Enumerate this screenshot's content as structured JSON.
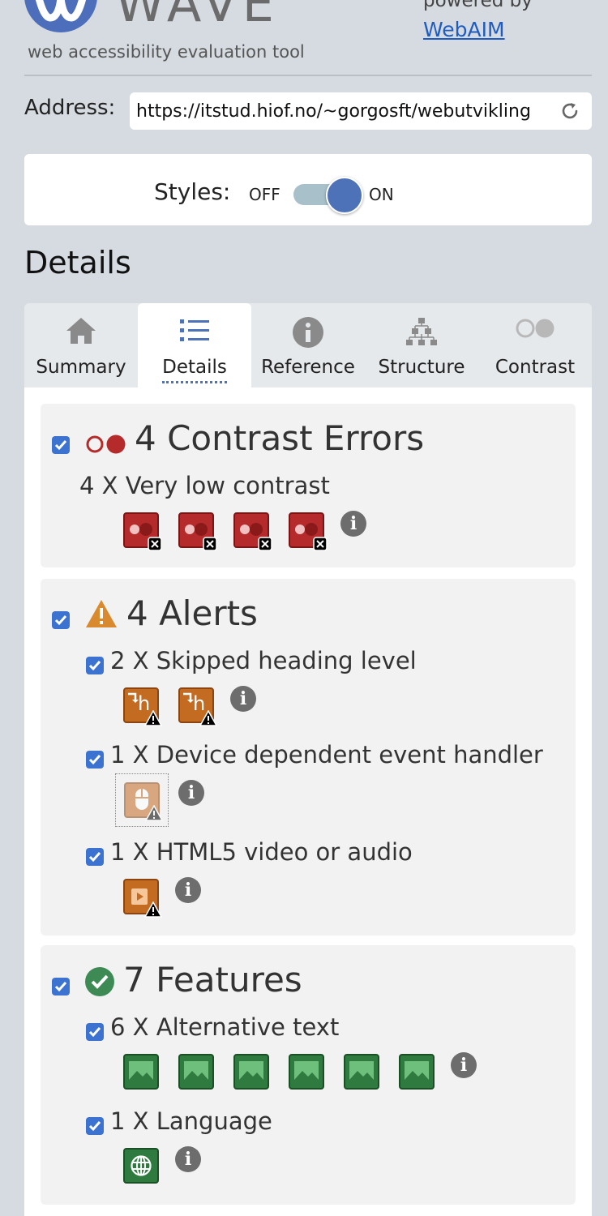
{
  "header": {
    "wordmark": "WAVE",
    "tagline": "web accessibility evaluation tool",
    "powered_by": "powered by",
    "webaim_link": "WebAIM"
  },
  "address": {
    "label": "Address:",
    "value": "https://itstud.hiof.no/~gorgosft/webutvikling"
  },
  "styles": {
    "label": "Styles:",
    "off": "OFF",
    "on": "ON",
    "state": "on"
  },
  "details_heading": "Details",
  "tabs": [
    {
      "label": "Summary",
      "icon": "home-icon"
    },
    {
      "label": "Details",
      "icon": "list-icon",
      "active": true
    },
    {
      "label": "Reference",
      "icon": "info-icon"
    },
    {
      "label": "Structure",
      "icon": "hierarchy-icon"
    },
    {
      "label": "Contrast",
      "icon": "contrast-icon"
    }
  ],
  "groups": {
    "contrast": {
      "title": "4 Contrast Errors",
      "items": [
        {
          "label": "4 X Very low contrast",
          "count": 4
        }
      ]
    },
    "alerts": {
      "title": "4 Alerts",
      "items": [
        {
          "label": "2 X Skipped heading level",
          "count": 2
        },
        {
          "label": "1 X Device dependent event handler",
          "count": 1
        },
        {
          "label": "1 X HTML5 video or audio",
          "count": 1
        }
      ]
    },
    "features": {
      "title": "7 Features",
      "items": [
        {
          "label": "6 X Alternative text",
          "count": 6
        },
        {
          "label": "1 X Language",
          "count": 1
        }
      ]
    }
  },
  "colors": {
    "brand": "#4d6ebb",
    "error": "#b52a2a",
    "alert": "#c46b22",
    "feature": "#2f7a3f",
    "checkbox": "#3c73d0"
  }
}
